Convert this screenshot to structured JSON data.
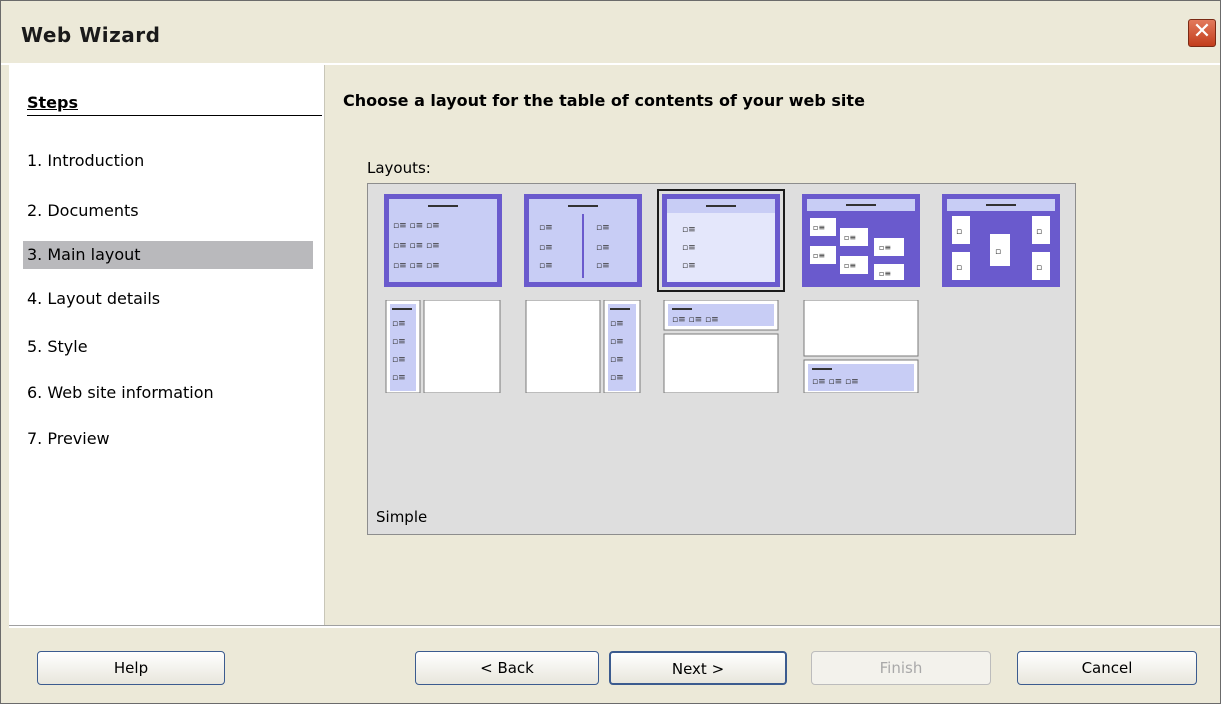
{
  "window": {
    "title": "Web Wizard"
  },
  "steps": {
    "title": "Steps",
    "items": [
      {
        "label": "1.  Introduction",
        "active": false
      },
      {
        "label": "2.  Documents",
        "active": false
      },
      {
        "label": "3.  Main layout",
        "active": true
      },
      {
        "label": "4.  Layout details",
        "active": false
      },
      {
        "label": "5.  Style",
        "active": false
      },
      {
        "label": "6.  Web site information",
        "active": false
      },
      {
        "label": "7.  Preview",
        "active": false
      }
    ]
  },
  "main": {
    "heading": "Choose a layout for the table of contents of your web site",
    "layouts_label": "Layouts:",
    "selected_caption": "Simple"
  },
  "buttons": {
    "help": "Help",
    "back": "< Back",
    "next": "Next >",
    "finish": "Finish",
    "cancel": "Cancel"
  },
  "colors": {
    "accent": "#6a5acd",
    "accent_light": "#c8cdf5",
    "steps_active": "#b9b9bc"
  }
}
